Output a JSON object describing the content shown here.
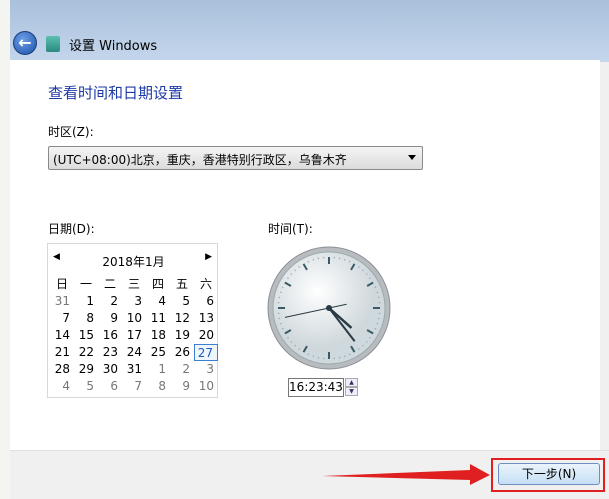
{
  "window": {
    "title": "设置 Windows"
  },
  "page": {
    "heading": "查看时间和日期设置"
  },
  "timezone": {
    "label": "时区(Z):",
    "value": "(UTC+08:00)北京，重庆，香港特别行政区，乌鲁木齐"
  },
  "date": {
    "label": "日期(D):",
    "month_label": "2018年1月",
    "weekdays": [
      "日",
      "一",
      "二",
      "三",
      "四",
      "五",
      "六"
    ],
    "days": [
      "31",
      "1",
      "2",
      "3",
      "4",
      "5",
      "6",
      "7",
      "8",
      "9",
      "10",
      "11",
      "12",
      "13",
      "14",
      "15",
      "16",
      "17",
      "18",
      "19",
      "20",
      "21",
      "22",
      "23",
      "24",
      "25",
      "26",
      "27",
      "28",
      "29",
      "30",
      "31",
      "1",
      "2",
      "3",
      "4",
      "5",
      "6",
      "7",
      "8",
      "9",
      "10"
    ],
    "selected": "27"
  },
  "time": {
    "label": "时间(T):",
    "value": "16:23:43",
    "hour": 16,
    "minute": 23,
    "second": 43
  },
  "footer": {
    "next_label": "下一步(N)"
  },
  "colors": {
    "heading": "#1e3aa8",
    "highlight": "#e02020"
  }
}
